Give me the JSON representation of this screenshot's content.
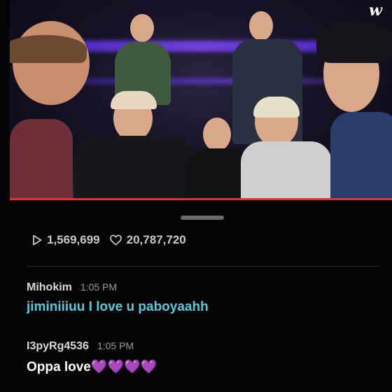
{
  "brand": {
    "logo_text": "w"
  },
  "video": {
    "progress_fraction": 0.0,
    "accent_color": "#e0322f"
  },
  "stats": {
    "plays": "1,569,699",
    "likes": "20,787,720"
  },
  "comments": [
    {
      "user": "Mihokim",
      "time": "1:05 PM",
      "text": "jiminiiiuu I love u paboyaahh",
      "text_color": "#5ac8d9"
    },
    {
      "user": "I3pyRg4536",
      "time": "1:05 PM",
      "text": "Oppa love💜💜💜💜",
      "text_color": "#ffffff"
    }
  ]
}
